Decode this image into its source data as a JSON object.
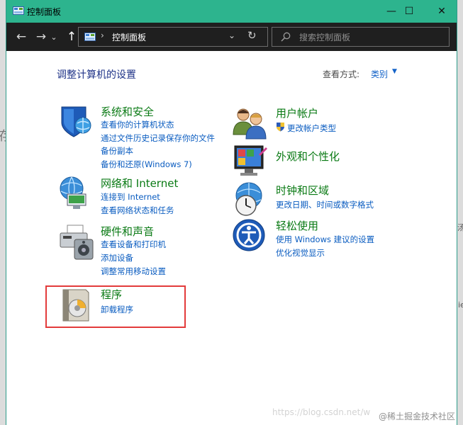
{
  "window": {
    "title": "控制面板",
    "minimize_glyph": "—",
    "maximize_glyph": "☐",
    "close_glyph": "✕"
  },
  "nav": {
    "back_glyph": "←",
    "forward_glyph": "→",
    "recent_glyph": "⌄",
    "up_glyph": "↑"
  },
  "address": {
    "separator": "›",
    "path": "控制面板",
    "dropdown_glyph": "⌄",
    "refresh_glyph": "↻"
  },
  "search": {
    "placeholder": "搜索控制面板"
  },
  "header": {
    "title": "调整计算机的设置",
    "view_label": "查看方式:",
    "view_value": "类别",
    "view_caret": "▼"
  },
  "categories": [
    {
      "icon": "shield-globe-icon",
      "title": "系统和安全",
      "links": [
        "查看你的计算机状态",
        "通过文件历史记录保存你的文件",
        "备份副本",
        "备份和还原(Windows 7)"
      ]
    },
    {
      "icon": "network-globe-icon",
      "title": "网络和 Internet",
      "links": [
        "连接到 Internet",
        "查看网络状态和任务"
      ]
    },
    {
      "icon": "printer-speaker-icon",
      "title": "硬件和声音",
      "links": [
        "查看设备和打印机",
        "添加设备",
        "调整常用移动设置"
      ]
    },
    {
      "icon": "programs-disc-icon",
      "title": "程序",
      "links": [
        "卸载程序"
      ]
    },
    {
      "icon": "users-icon",
      "title": "用户帐户",
      "links": [
        "更改帐户类型"
      ]
    },
    {
      "icon": "display-personalization-icon",
      "title": "外观和个性化",
      "links": []
    },
    {
      "icon": "clock-globe-icon",
      "title": "时钟和区域",
      "links": [
        "更改日期、时间或数字格式"
      ]
    },
    {
      "icon": "ease-of-access-icon",
      "title": "轻松使用",
      "links": [
        "使用 Windows 建议的设置",
        "优化视觉显示"
      ]
    }
  ],
  "watermarks": {
    "csdn": "https://blog.csdn.net/w",
    "juejin": "@稀土掘金技术社区"
  },
  "background_fragments": {
    "left_top": "存",
    "right_mid": "汤",
    "right_low": "ie"
  },
  "colors": {
    "titlebar": "#2db48e",
    "navbar": "#1f1f1f",
    "link": "#0a5cc0",
    "category_title": "#0a7a14",
    "page_title": "#1e3287",
    "highlight_box": "#e33b3b"
  }
}
